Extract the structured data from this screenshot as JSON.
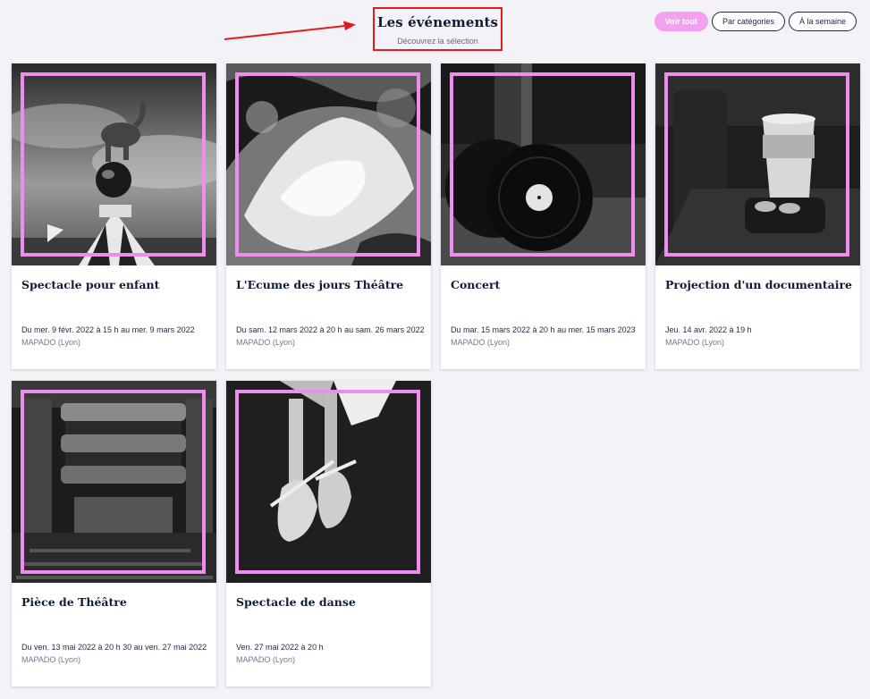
{
  "header": {
    "title": "Les événements",
    "subtitle": "Découvrez la sélection"
  },
  "filters": [
    {
      "label": "Voir tout",
      "active": true
    },
    {
      "label": "Par catégories",
      "active": false
    },
    {
      "label": "À la semaine",
      "active": false
    }
  ],
  "colors": {
    "accent": "#f4a0f0",
    "frame": "#f08cf0",
    "annotation": "#e01b1b",
    "background": "#f3f2f6"
  },
  "events": [
    {
      "title": "Spectacle pour enfant",
      "date": "Du mer. 9 févr. 2022 à 15 h au mer. 9 mars 2022",
      "place": "MAPADO (Lyon)",
      "image": "circus-elephant"
    },
    {
      "title": "L'Ecume des jours Théâtre",
      "date": "Du sam. 12 mars 2022 à 20 h au sam. 26 mars 2022",
      "place": "MAPADO (Lyon)",
      "image": "ocean-wave"
    },
    {
      "title": "Concert",
      "date": "Du mar. 15 mars 2022 à 20 h au mer. 15 mars 2023",
      "place": "MAPADO (Lyon)",
      "image": "vinyl-record"
    },
    {
      "title": "Projection d'un documentaire",
      "date": "Jeu. 14 avr. 2022 à 19 h",
      "place": "MAPADO (Lyon)",
      "image": "popcorn-cinema"
    },
    {
      "title": "Pièce de Théâtre",
      "date": "Du ven. 13 mai 2022 à 20 h 30 au ven. 27 mai 2022",
      "place": "MAPADO (Lyon)",
      "image": "theatre-balconies"
    },
    {
      "title": "Spectacle de danse",
      "date": "Ven. 27 mai 2022 à 20 h",
      "place": "MAPADO (Lyon)",
      "image": "ballet-shoes"
    }
  ]
}
